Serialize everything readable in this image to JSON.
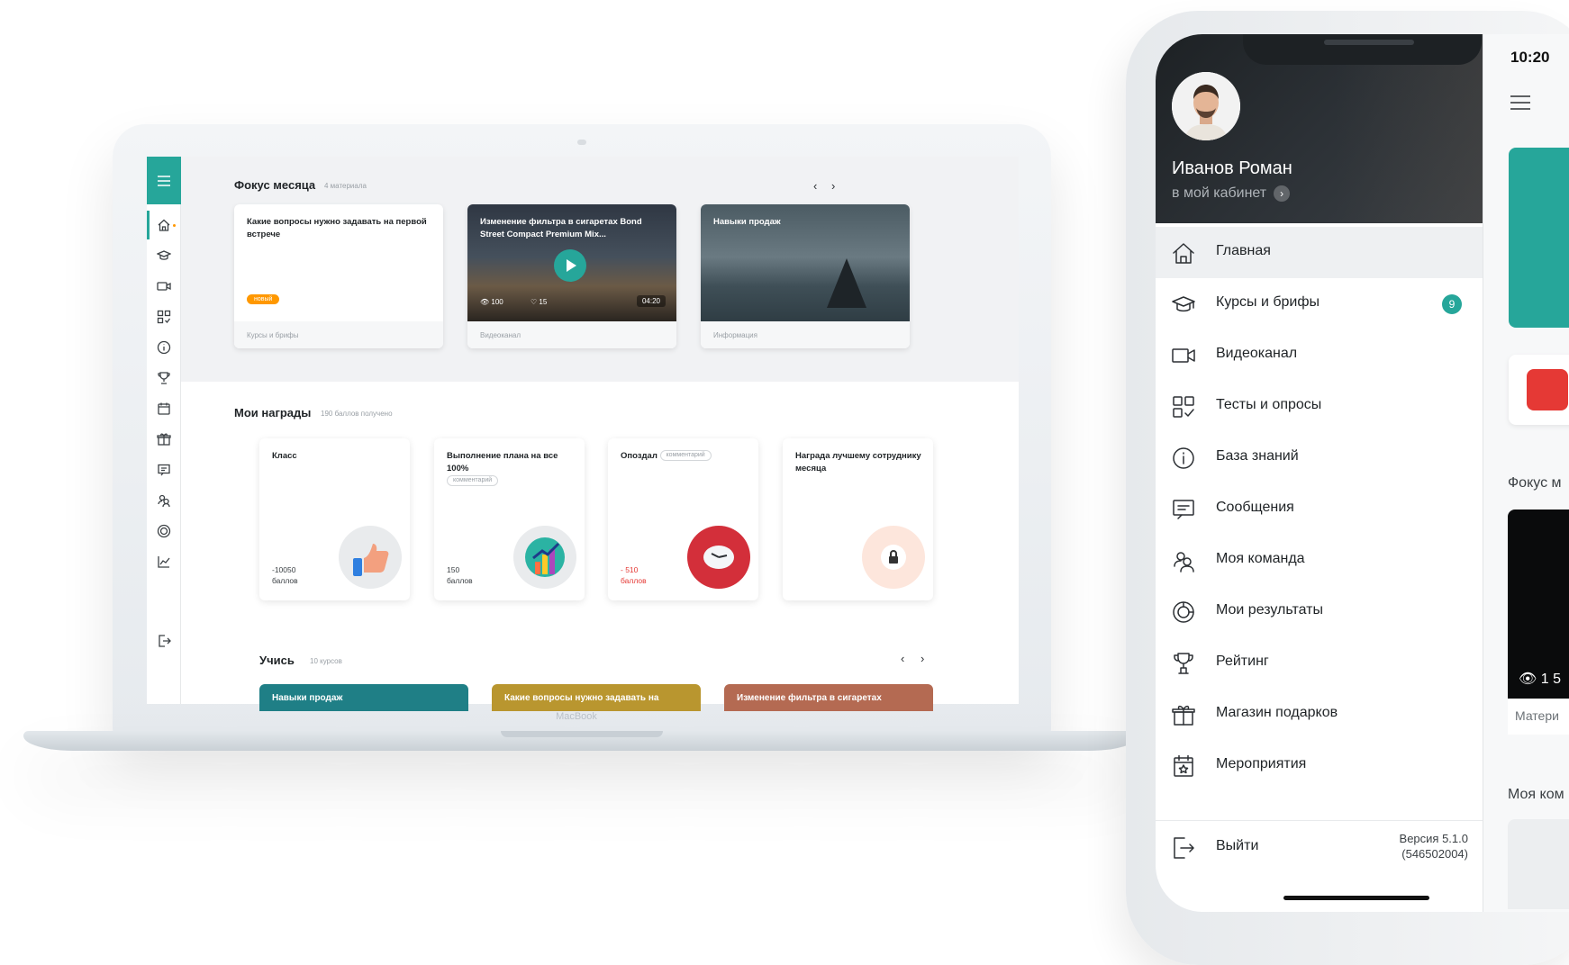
{
  "laptop": {
    "brand": "MacBook",
    "focus": {
      "title": "Фокус месяца",
      "subtitle": "4 материала",
      "cards": [
        {
          "title": "Какие вопросы нужно задавать на первой встрече",
          "badge": "новый",
          "category": "Курсы и брифы"
        },
        {
          "title": "Изменение фильтра в сигаретах Bond Street Compact Premium Mix...",
          "views": "100",
          "likes": "15",
          "duration": "04:20",
          "category": "Видеоканал"
        },
        {
          "title": "Навыки продаж",
          "category": "Информация"
        }
      ]
    },
    "awards": {
      "title": "Мои награды",
      "subtitle": "190 баллов получено",
      "items": [
        {
          "title": "Класс",
          "points": "-10050",
          "unit": "баллов"
        },
        {
          "title": "Выполнение плана на все 100%",
          "comment": "комментарий",
          "points": "150",
          "unit": "баллов"
        },
        {
          "title": "Опоздал",
          "comment": "комментарий",
          "points": "- 510",
          "unit": "баллов"
        },
        {
          "title": "Награда лучшему сотруднику месяца"
        }
      ]
    },
    "learn": {
      "title": "Учись",
      "subtitle": "10 курсов",
      "cards": [
        "Навыки продаж",
        "Какие вопросы нужно задавать на",
        "Изменение фильтра в сигаретах"
      ]
    },
    "colors": {
      "accent": "#26a69a",
      "badge": "#ff9800",
      "negative": "#e53935"
    }
  },
  "phone": {
    "status_time": "10:20",
    "user": {
      "name": "Иванов Роман",
      "cabinet_link": "в мой кабинет"
    },
    "menu": [
      {
        "label": "Главная",
        "icon": "home-icon"
      },
      {
        "label": "Курсы и брифы",
        "icon": "graduation-cap-icon",
        "count": "9"
      },
      {
        "label": "Видеоканал",
        "icon": "video-camera-icon"
      },
      {
        "label": "Тесты и опросы",
        "icon": "tests-grid-icon"
      },
      {
        "label": "База знаний",
        "icon": "info-icon"
      },
      {
        "label": "Сообщения",
        "icon": "message-icon"
      },
      {
        "label": "Моя команда",
        "icon": "team-icon"
      },
      {
        "label": "Мои результаты",
        "icon": "results-icon"
      },
      {
        "label": "Рейтинг",
        "icon": "trophy-icon"
      },
      {
        "label": "Магазин подарков",
        "icon": "gift-icon"
      },
      {
        "label": "Мероприятия",
        "icon": "calendar-star-icon"
      }
    ],
    "logout": "Выйти",
    "version_line1": "Версия 5.1.0",
    "version_line2": "(546502004)",
    "background": {
      "focus_label": "Фокус м",
      "team_label": "Моя ком",
      "card_views": "1 5",
      "card_footer": "Матери"
    }
  }
}
